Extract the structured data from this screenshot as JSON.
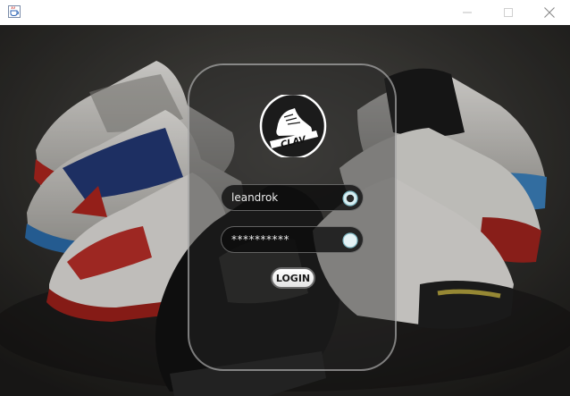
{
  "titlebar": {
    "app_icon": "java-coffee-cup-icon",
    "controls": [
      "minimize-icon",
      "maximize-icon",
      "close-icon"
    ]
  },
  "background": {
    "subject": "sneakers-photo"
  },
  "logo": {
    "text": "CLAV",
    "icon": "sneaker-logo-icon"
  },
  "login_form": {
    "username_value": "leandrok",
    "password_value": "**********",
    "username_icon": "radio-indicator-icon",
    "password_icon": "radio-indicator-icon",
    "login_label": "LOGIN"
  }
}
